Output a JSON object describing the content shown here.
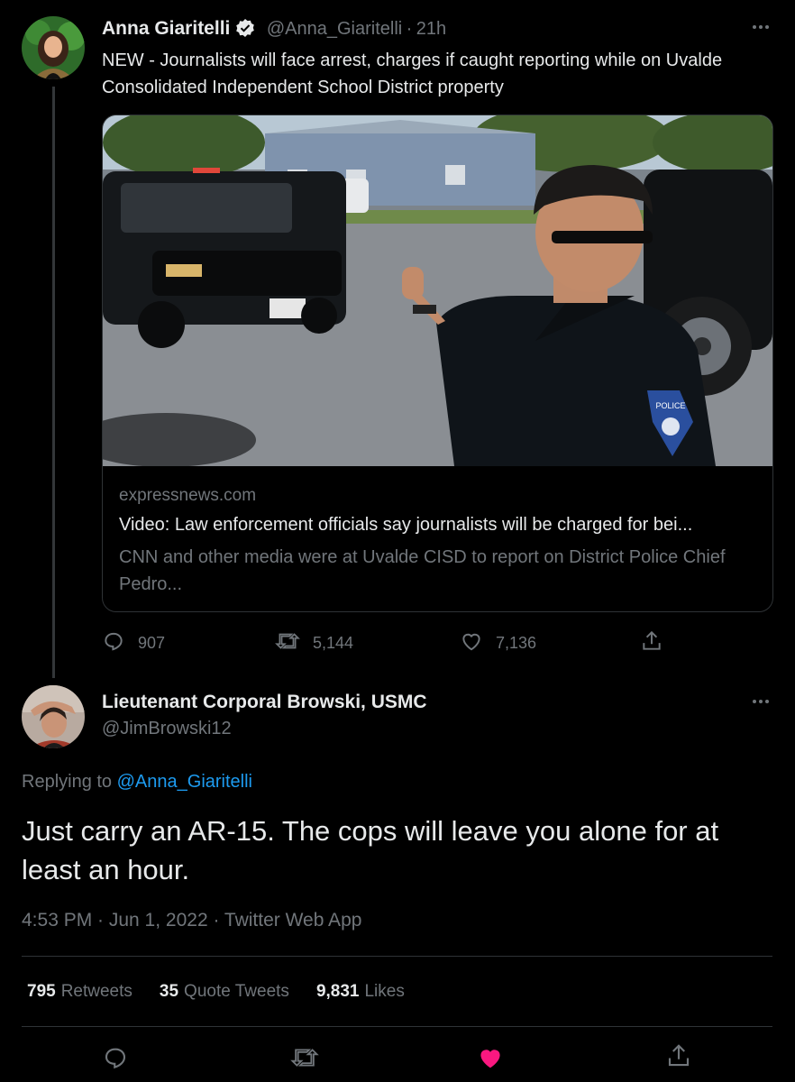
{
  "parent": {
    "display_name": "Anna Giaritelli",
    "handle": "@Anna_Giaritelli",
    "separator": "·",
    "time_ago": "21h",
    "text": "NEW - Journalists will face arrest, charges if caught reporting while on Uvalde Consolidated Independent School District property",
    "card": {
      "domain": "expressnews.com",
      "title": "Video: Law enforcement officials say journalists will be charged for bei...",
      "description": "CNN and other media were at Uvalde CISD to report on District Police Chief Pedro...",
      "badge_text": "POLICE"
    },
    "actions": {
      "replies": "907",
      "retweets": "5,144",
      "likes": "7,136"
    },
    "more_icon": "more-horizontal-icon"
  },
  "reply": {
    "display_name": "Lieutenant Corporal Browski, USMC",
    "handle": "@JimBrowski12",
    "replying_to_prefix": "Replying to",
    "replying_to_handle": "@Anna_Giaritelli",
    "text": "Just carry an AR-15. The cops will leave you alone for at least an hour.",
    "timestamp": "4:53 PM · Jun 1, 2022 · Twitter Web App",
    "stats": {
      "retweets_count": "795",
      "retweets_label": "Retweets",
      "quotes_count": "35",
      "quotes_label": "Quote Tweets",
      "likes_count": "9,831",
      "likes_label": "Likes"
    },
    "liked": true
  },
  "colors": {
    "background": "#000000",
    "text": "#e7e9ea",
    "muted": "#71767b",
    "link": "#1d9bf0",
    "like_active": "#f91880",
    "border": "#2f3336"
  }
}
